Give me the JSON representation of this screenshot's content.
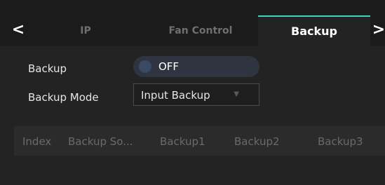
{
  "tabs": {
    "ip": "IP",
    "fan_control": "Fan Control",
    "backup": "Backup",
    "active": "Backup"
  },
  "nav": {
    "prev": "<",
    "next": ">"
  },
  "backup": {
    "label": "Backup",
    "toggle_value": "OFF"
  },
  "backup_mode": {
    "label": "Backup Mode",
    "selected": "Input Backup"
  },
  "table": {
    "columns": [
      "Index",
      "Backup So...",
      "Backup1",
      "Backup2",
      "Backup3"
    ]
  },
  "colors": {
    "accent": "#3fd1c6",
    "background": "#1b1b1b",
    "panel": "#232323"
  }
}
